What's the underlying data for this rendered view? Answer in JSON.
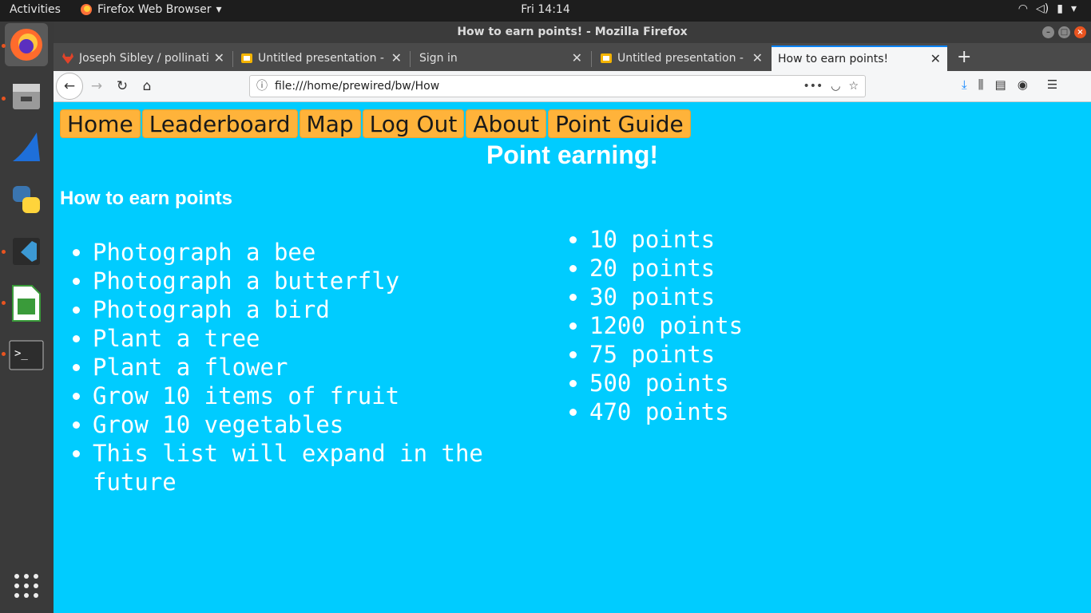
{
  "system": {
    "activities": "Activities",
    "app_menu": "Firefox Web Browser",
    "clock": "Fri 14:14"
  },
  "window": {
    "title": "How to earn points! - Mozilla Firefox"
  },
  "tabs": [
    {
      "label": "Joseph Sibley / pollinatio"
    },
    {
      "label": "Untitled presentation - G"
    },
    {
      "label": "Sign in"
    },
    {
      "label": "Untitled presentation - G"
    },
    {
      "label": "How to earn points!"
    }
  ],
  "url": "file:///home/prewired/bw/How",
  "page": {
    "menu": [
      "Home",
      "Leaderboard",
      "Map",
      "Log Out",
      "About",
      "Point Guide"
    ],
    "heading": "Point earning!",
    "subheading": "How to earn points",
    "activities": [
      "Photograph a bee",
      "Photograph a butterfly",
      "Photograph a bird",
      "Plant a tree",
      "Plant a flower",
      "Grow 10 items of fruit",
      "Grow 10 vegetables",
      "This list will expand in the future"
    ],
    "points": [
      "10 points",
      "20 points",
      "30 points",
      "1200 points",
      "75 points",
      "500 points",
      "470 points"
    ]
  },
  "dock": [
    "firefox-icon",
    "files-icon",
    "wireshark-icon",
    "python-icon",
    "vscode-icon",
    "calc-icon",
    "terminal-icon",
    "app-grid-icon"
  ],
  "colors": {
    "page_bg": "#00ccff",
    "menu_button": "#ffb33a"
  }
}
